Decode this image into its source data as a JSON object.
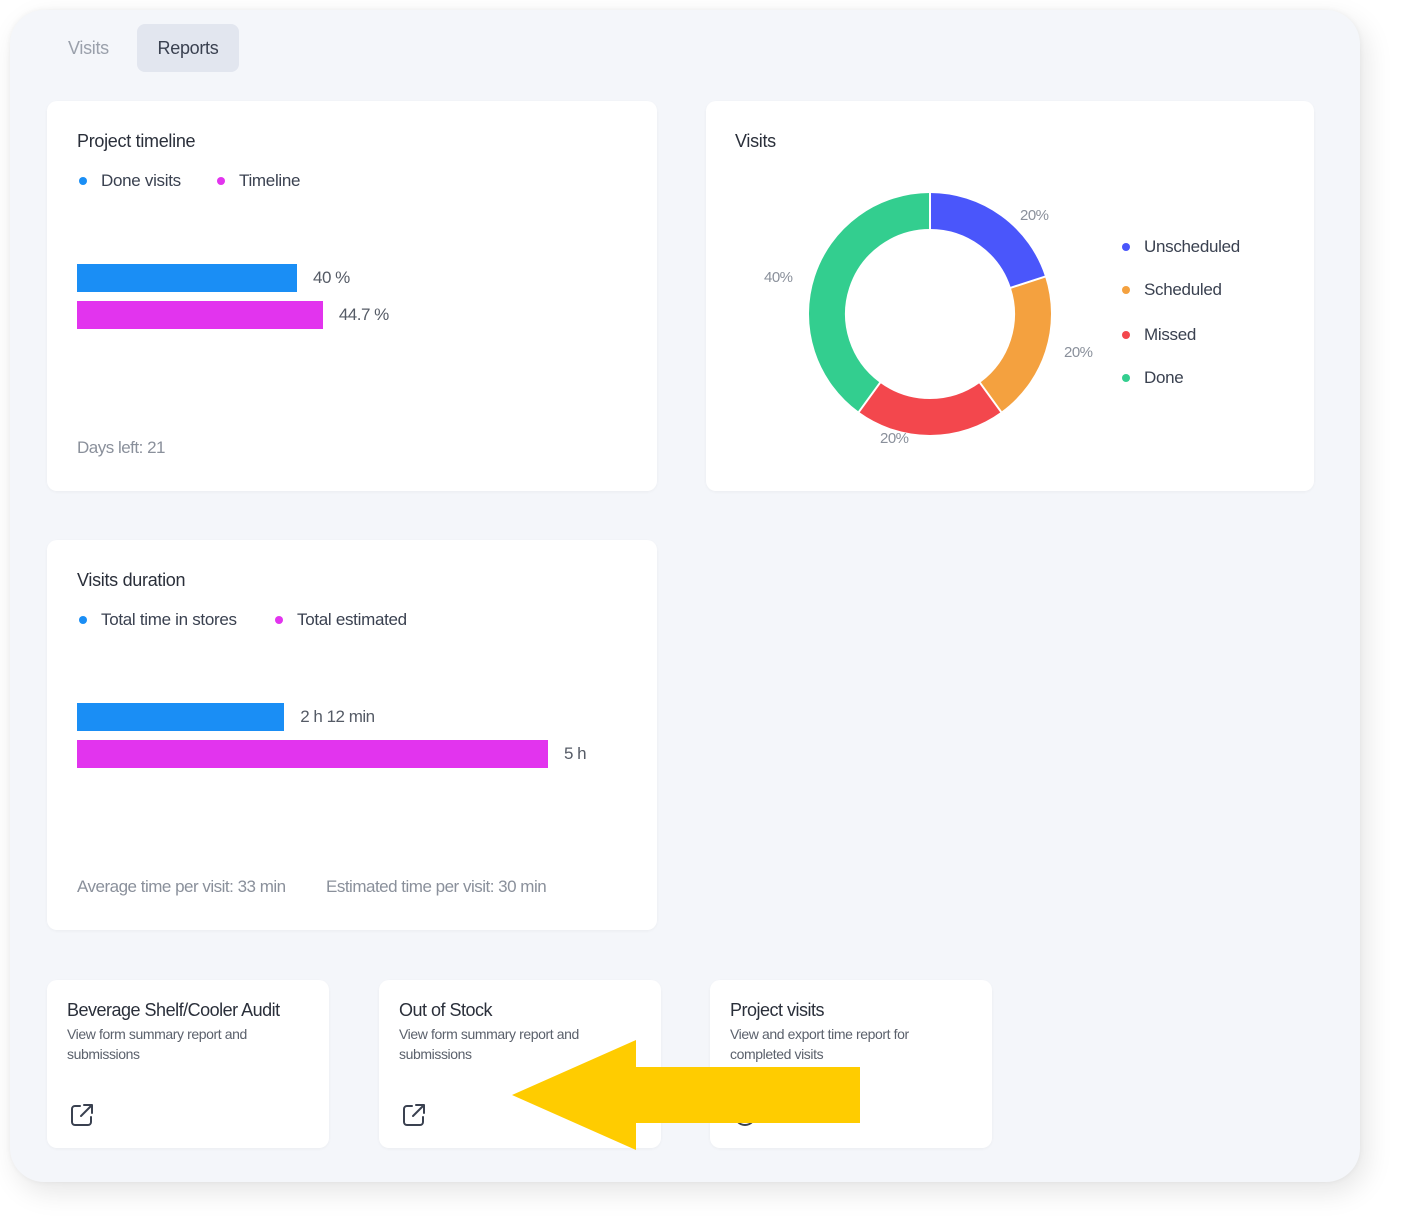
{
  "tabs": [
    {
      "label": "Visits",
      "active": false
    },
    {
      "label": "Reports",
      "active": true
    }
  ],
  "project_timeline": {
    "title": "Project timeline",
    "legend": [
      {
        "label": "Done visits",
        "color": "#1a8ef5"
      },
      {
        "label": "Timeline",
        "color": "#e234ee"
      }
    ],
    "bars": [
      {
        "name": "Done visits",
        "value": 40,
        "label": "40 %"
      },
      {
        "name": "Timeline",
        "value": 44.7,
        "label": "44.7 %"
      }
    ],
    "footer": "Days left: 21"
  },
  "visits": {
    "title": "Visits",
    "legend": [
      {
        "label": "Unscheduled",
        "color": "#4a56fb"
      },
      {
        "label": "Scheduled",
        "color": "#f4a13f"
      },
      {
        "label": "Missed",
        "color": "#f3474d"
      },
      {
        "label": "Done",
        "color": "#33ce8f"
      }
    ],
    "slice_labels": [
      "20%",
      "20%",
      "20%",
      "40%"
    ]
  },
  "visits_duration": {
    "title": "Visits duration",
    "legend": [
      {
        "label": "Total time in stores",
        "color": "#1a8ef5"
      },
      {
        "label": "Total estimated",
        "color": "#e234ee"
      }
    ],
    "bars": [
      {
        "name": "Total time in stores",
        "minutes": 132,
        "label": "2 h 12 min"
      },
      {
        "name": "Total estimated",
        "minutes": 300,
        "label": "5 h"
      }
    ],
    "footer_avg": "Average time per visit: 33 min",
    "footer_est": "Estimated time per visit: 30 min"
  },
  "chart_data": [
    {
      "type": "bar",
      "title": "Project timeline",
      "categories": [
        "Done visits",
        "Timeline"
      ],
      "values": [
        40,
        44.7
      ],
      "unit": "%",
      "xlim": [
        0,
        100
      ]
    },
    {
      "type": "pie",
      "title": "Visits",
      "categories": [
        "Unscheduled",
        "Scheduled",
        "Missed",
        "Done"
      ],
      "values": [
        20,
        20,
        20,
        40
      ],
      "unit": "%",
      "colors": [
        "#4a56fb",
        "#f4a13f",
        "#f3474d",
        "#33ce8f"
      ]
    },
    {
      "type": "bar",
      "title": "Visits duration",
      "categories": [
        "Total time in stores",
        "Total estimated"
      ],
      "values": [
        132,
        300
      ],
      "unit": "min"
    }
  ],
  "report_cards": [
    {
      "title": "Beverage Shelf/Cooler Audit",
      "description": "View form summary report and submissions",
      "icon": "external-link-icon"
    },
    {
      "title": "Out of Stock",
      "description": "View form summary report and submissions",
      "icon": "external-link-icon"
    },
    {
      "title": "Project visits",
      "description": "View and export time report for completed visits",
      "icon": "clock-icon"
    }
  ],
  "annotation": {
    "arrow_color": "#ffcc00"
  }
}
